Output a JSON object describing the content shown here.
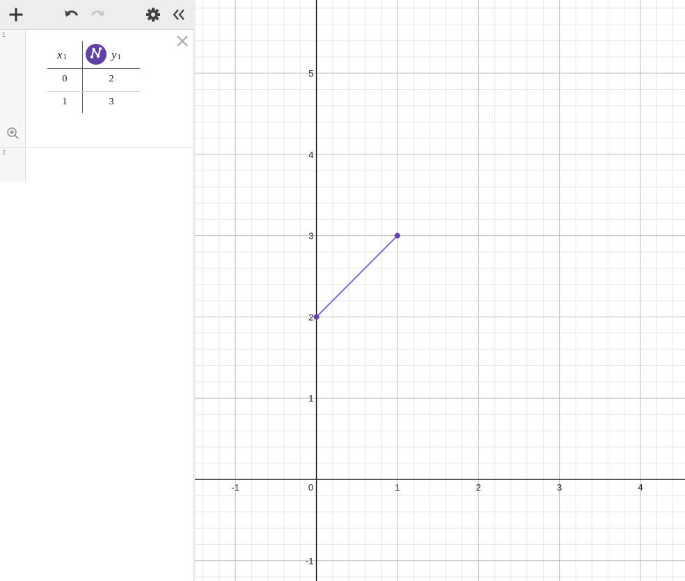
{
  "toolbar": {
    "add_icon": "plus-icon",
    "undo_icon": "undo-icon",
    "redo_icon": "redo-icon",
    "settings_icon": "gear-icon",
    "collapse_icon": "double-chevron-left-icon"
  },
  "expressions": [
    {
      "index": "1",
      "type": "table",
      "columns": [
        {
          "var": "x",
          "sub": "1"
        },
        {
          "var": "y",
          "sub": "1"
        }
      ],
      "rows": [
        [
          "0",
          "2"
        ],
        [
          "1",
          "3"
        ]
      ],
      "series_color": "#6042a6",
      "series_icon": "lines-and-points-icon"
    },
    {
      "index": "2",
      "type": "empty"
    }
  ],
  "graph": {
    "x_ticks": [
      "-1",
      "0",
      "1",
      "2",
      "3",
      "4"
    ],
    "y_ticks": [
      "-1",
      "1",
      "2",
      "3",
      "4",
      "5"
    ],
    "xlim": [
      -1.5,
      4.55
    ],
    "ylim": [
      -1.25,
      5.9
    ],
    "major_step": 1,
    "minor_step": 0.2,
    "colors": {
      "major_grid": "#bdbdbd",
      "minor_grid": "#e8e8e8",
      "axis": "#111111",
      "series": "#7e6cc8",
      "point": "#6042a6"
    }
  },
  "chart_data": {
    "type": "line",
    "x": [
      0,
      1
    ],
    "series": [
      {
        "values": [
          2,
          3
        ]
      }
    ],
    "xlim": [
      -1.5,
      4.55
    ],
    "ylim": [
      -1.25,
      5.9
    ],
    "grid": true
  }
}
